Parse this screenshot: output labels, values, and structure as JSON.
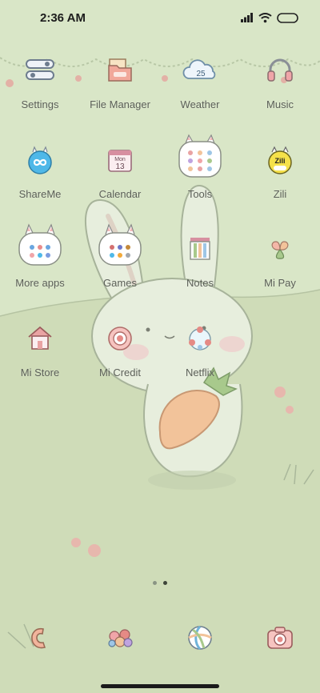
{
  "status_bar": {
    "time": "2:36 AM"
  },
  "apps": [
    {
      "label": "Settings",
      "icon": "settings-icon"
    },
    {
      "label": "File Manager",
      "icon": "folder-icon"
    },
    {
      "label": "Weather",
      "icon": "cloud-icon",
      "badge": "25"
    },
    {
      "label": "Music",
      "icon": "headphones-icon"
    },
    {
      "label": "ShareMe",
      "icon": "shareme-icon"
    },
    {
      "label": "Calendar",
      "icon": "calendar-icon",
      "day": "Mon",
      "date": "13"
    },
    {
      "label": "Tools",
      "icon": "tools-folder-icon"
    },
    {
      "label": "Zili",
      "icon": "zili-icon",
      "brand": "Zili"
    },
    {
      "label": "More apps",
      "icon": "more-apps-folder-icon"
    },
    {
      "label": "Games",
      "icon": "games-folder-icon"
    },
    {
      "label": "Notes",
      "icon": "notes-icon"
    },
    {
      "label": "Mi Pay",
      "icon": "mi-pay-icon"
    },
    {
      "label": "Mi Store",
      "icon": "house-icon"
    },
    {
      "label": "Mi Credit",
      "icon": "mi-credit-icon"
    },
    {
      "label": "Netflix",
      "icon": "netflix-icon"
    }
  ],
  "dock": [
    {
      "icon": "phone-icon"
    },
    {
      "icon": "flower-messages-icon"
    },
    {
      "icon": "ball-browser-icon"
    },
    {
      "icon": "camera-icon"
    }
  ],
  "page_indicator": {
    "total": 2,
    "active": 2
  },
  "colors": {
    "background": "#d9e6c7",
    "label": "#5b5f57",
    "accent_pink": "#e9a3a3",
    "accent_blue": "#4fb8e8"
  }
}
